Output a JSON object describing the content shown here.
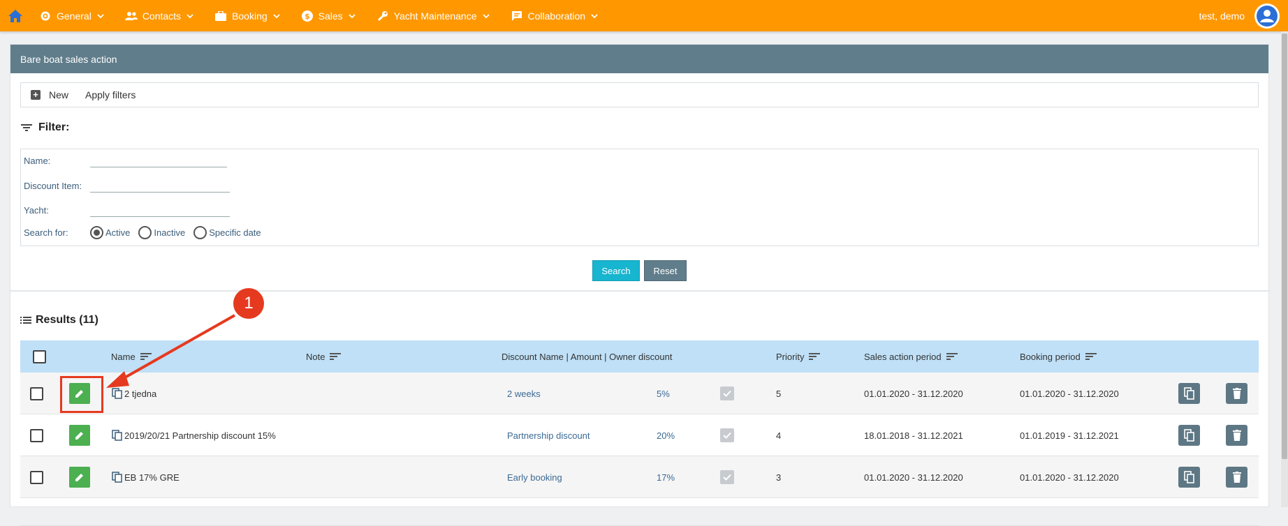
{
  "nav": {
    "items": [
      {
        "label": "General",
        "icon": "gear-icon"
      },
      {
        "label": "Contacts",
        "icon": "people-icon"
      },
      {
        "label": "Booking",
        "icon": "briefcase-icon"
      },
      {
        "label": "Sales",
        "icon": "dollar-icon"
      },
      {
        "label": "Yacht Maintenance",
        "icon": "wrench-icon"
      },
      {
        "label": "Collaboration",
        "icon": "chat-icon"
      }
    ],
    "user": "test, demo"
  },
  "panel": {
    "title": "Bare boat sales action",
    "toolbar": {
      "new_label": "New",
      "apply_label": "Apply filters"
    }
  },
  "filter": {
    "title": "Filter:",
    "name_label": "Name:",
    "discount_label": "Discount Item:",
    "yacht_label": "Yacht:",
    "search_for_label": "Search for:",
    "options": [
      "Active",
      "Inactive",
      "Specific date"
    ],
    "selected": "Active",
    "search_button": "Search",
    "reset_button": "Reset"
  },
  "results": {
    "title": "Results (11)",
    "columns": {
      "name": "Name",
      "note": "Note",
      "discount": "Discount Name | Amount | Owner discount",
      "priority": "Priority",
      "sales_period": "Sales action period",
      "booking_period": "Booking period"
    },
    "rows": [
      {
        "name": "2 tjedna",
        "discount_name": "2 weeks",
        "amount": "5%",
        "owner_discount": true,
        "priority": "5",
        "sales_period": "01.01.2020 - 31.12.2020",
        "booking_period": "01.01.2020 - 31.12.2020"
      },
      {
        "name": "2019/20/21 Partnership discount 15%",
        "discount_name": "Partnership discount",
        "amount": "20%",
        "owner_discount": true,
        "priority": "4",
        "sales_period": "18.01.2018 - 31.12.2021",
        "booking_period": "01.01.2019 - 31.12.2021"
      },
      {
        "name": "EB 17% GRE",
        "discount_name": "Early booking",
        "amount": "17%",
        "owner_discount": true,
        "priority": "3",
        "sales_period": "01.01.2020 - 31.12.2020",
        "booking_period": "01.01.2020 - 31.12.2020"
      }
    ]
  },
  "annotation": {
    "step": "1"
  },
  "colors": {
    "topbar": "#ff9800",
    "panel_header": "#607d8b",
    "table_header": "#bfe0f7",
    "edit_button": "#4caf50",
    "search_button": "#17b5cf",
    "annotation": "#e53a1f"
  }
}
